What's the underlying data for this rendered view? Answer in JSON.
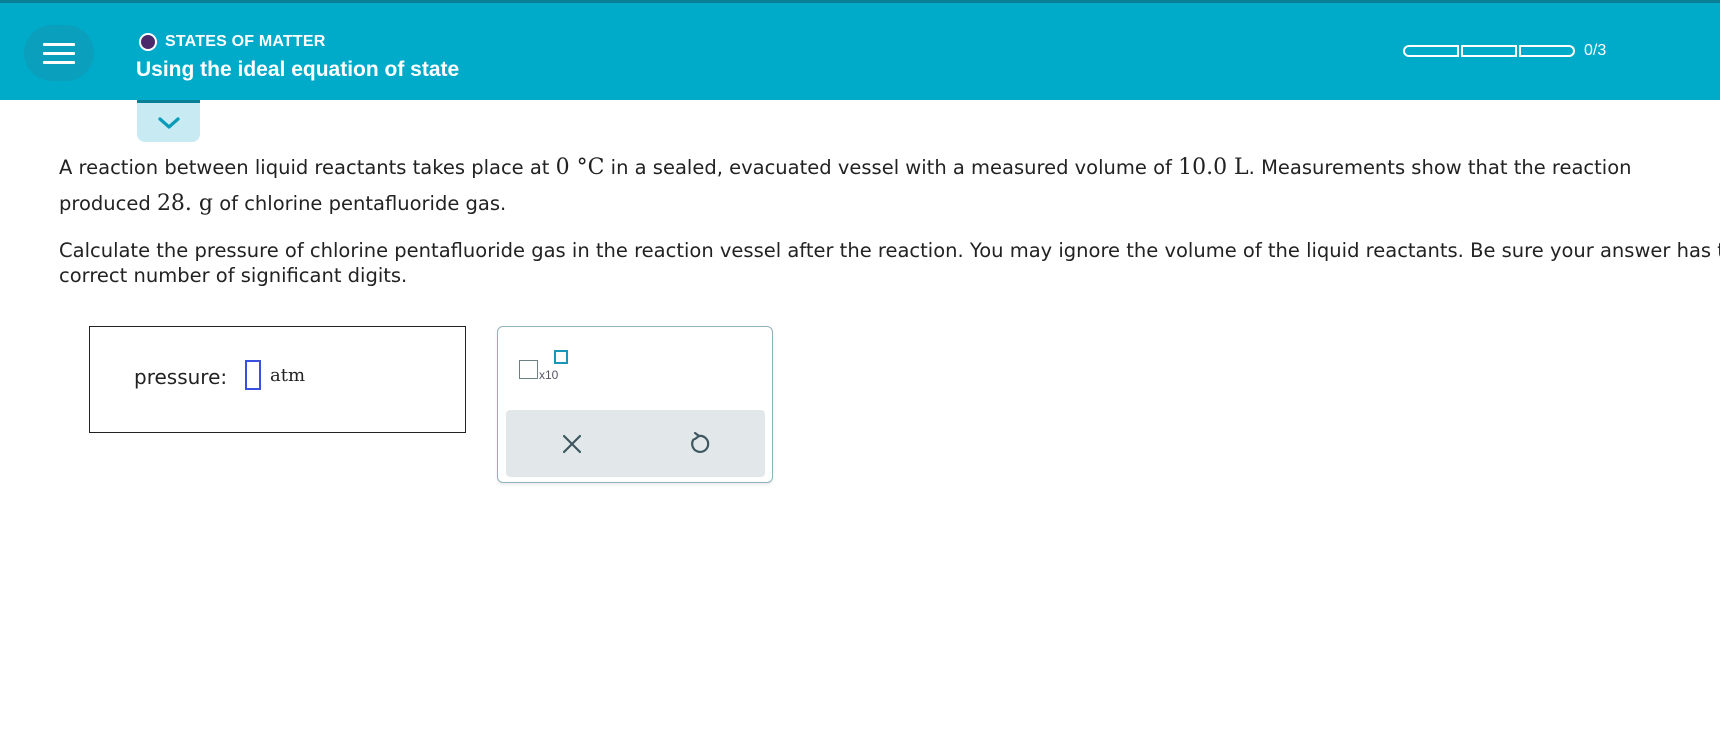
{
  "header": {
    "menu_icon": "hamburger-menu-icon",
    "topic": "STATES OF MATTER",
    "topic_dot_color": "#4b2a6b",
    "title": "Using the ideal equation of state",
    "progress_text": "0/3",
    "progress": {
      "completed": 0,
      "total": 3
    },
    "colors": {
      "header_bg": "#00abc9",
      "accent_dark": "#0a7f96"
    }
  },
  "collapse_tab": {
    "icon": "chevron-down-icon"
  },
  "problem": {
    "p1": {
      "t1": "A reaction between liquid reactants takes place at ",
      "m1": "0 °C",
      "t2": " in a sealed, evacuated vessel with a measured volume of ",
      "m2": "10.0 L",
      "t3": ". Measurements show that the reaction produced ",
      "m3": "28. g",
      "t4": " of chlorine pentafluoride gas."
    },
    "p2": "Calculate the pressure of chlorine pentafluoride gas in the reaction vessel after the reaction. You may ignore the volume of the liquid reactants. Be sure your answer has the correct number of significant digits."
  },
  "answer": {
    "label": "pressure:",
    "value": "",
    "unit": "atm",
    "input_border_color": "#3b4fe0"
  },
  "tools": {
    "sci_notation": {
      "icon": "scientific-notation-icon",
      "text": "x10"
    },
    "clear_icon": "close-icon",
    "reset_icon": "undo-icon"
  }
}
